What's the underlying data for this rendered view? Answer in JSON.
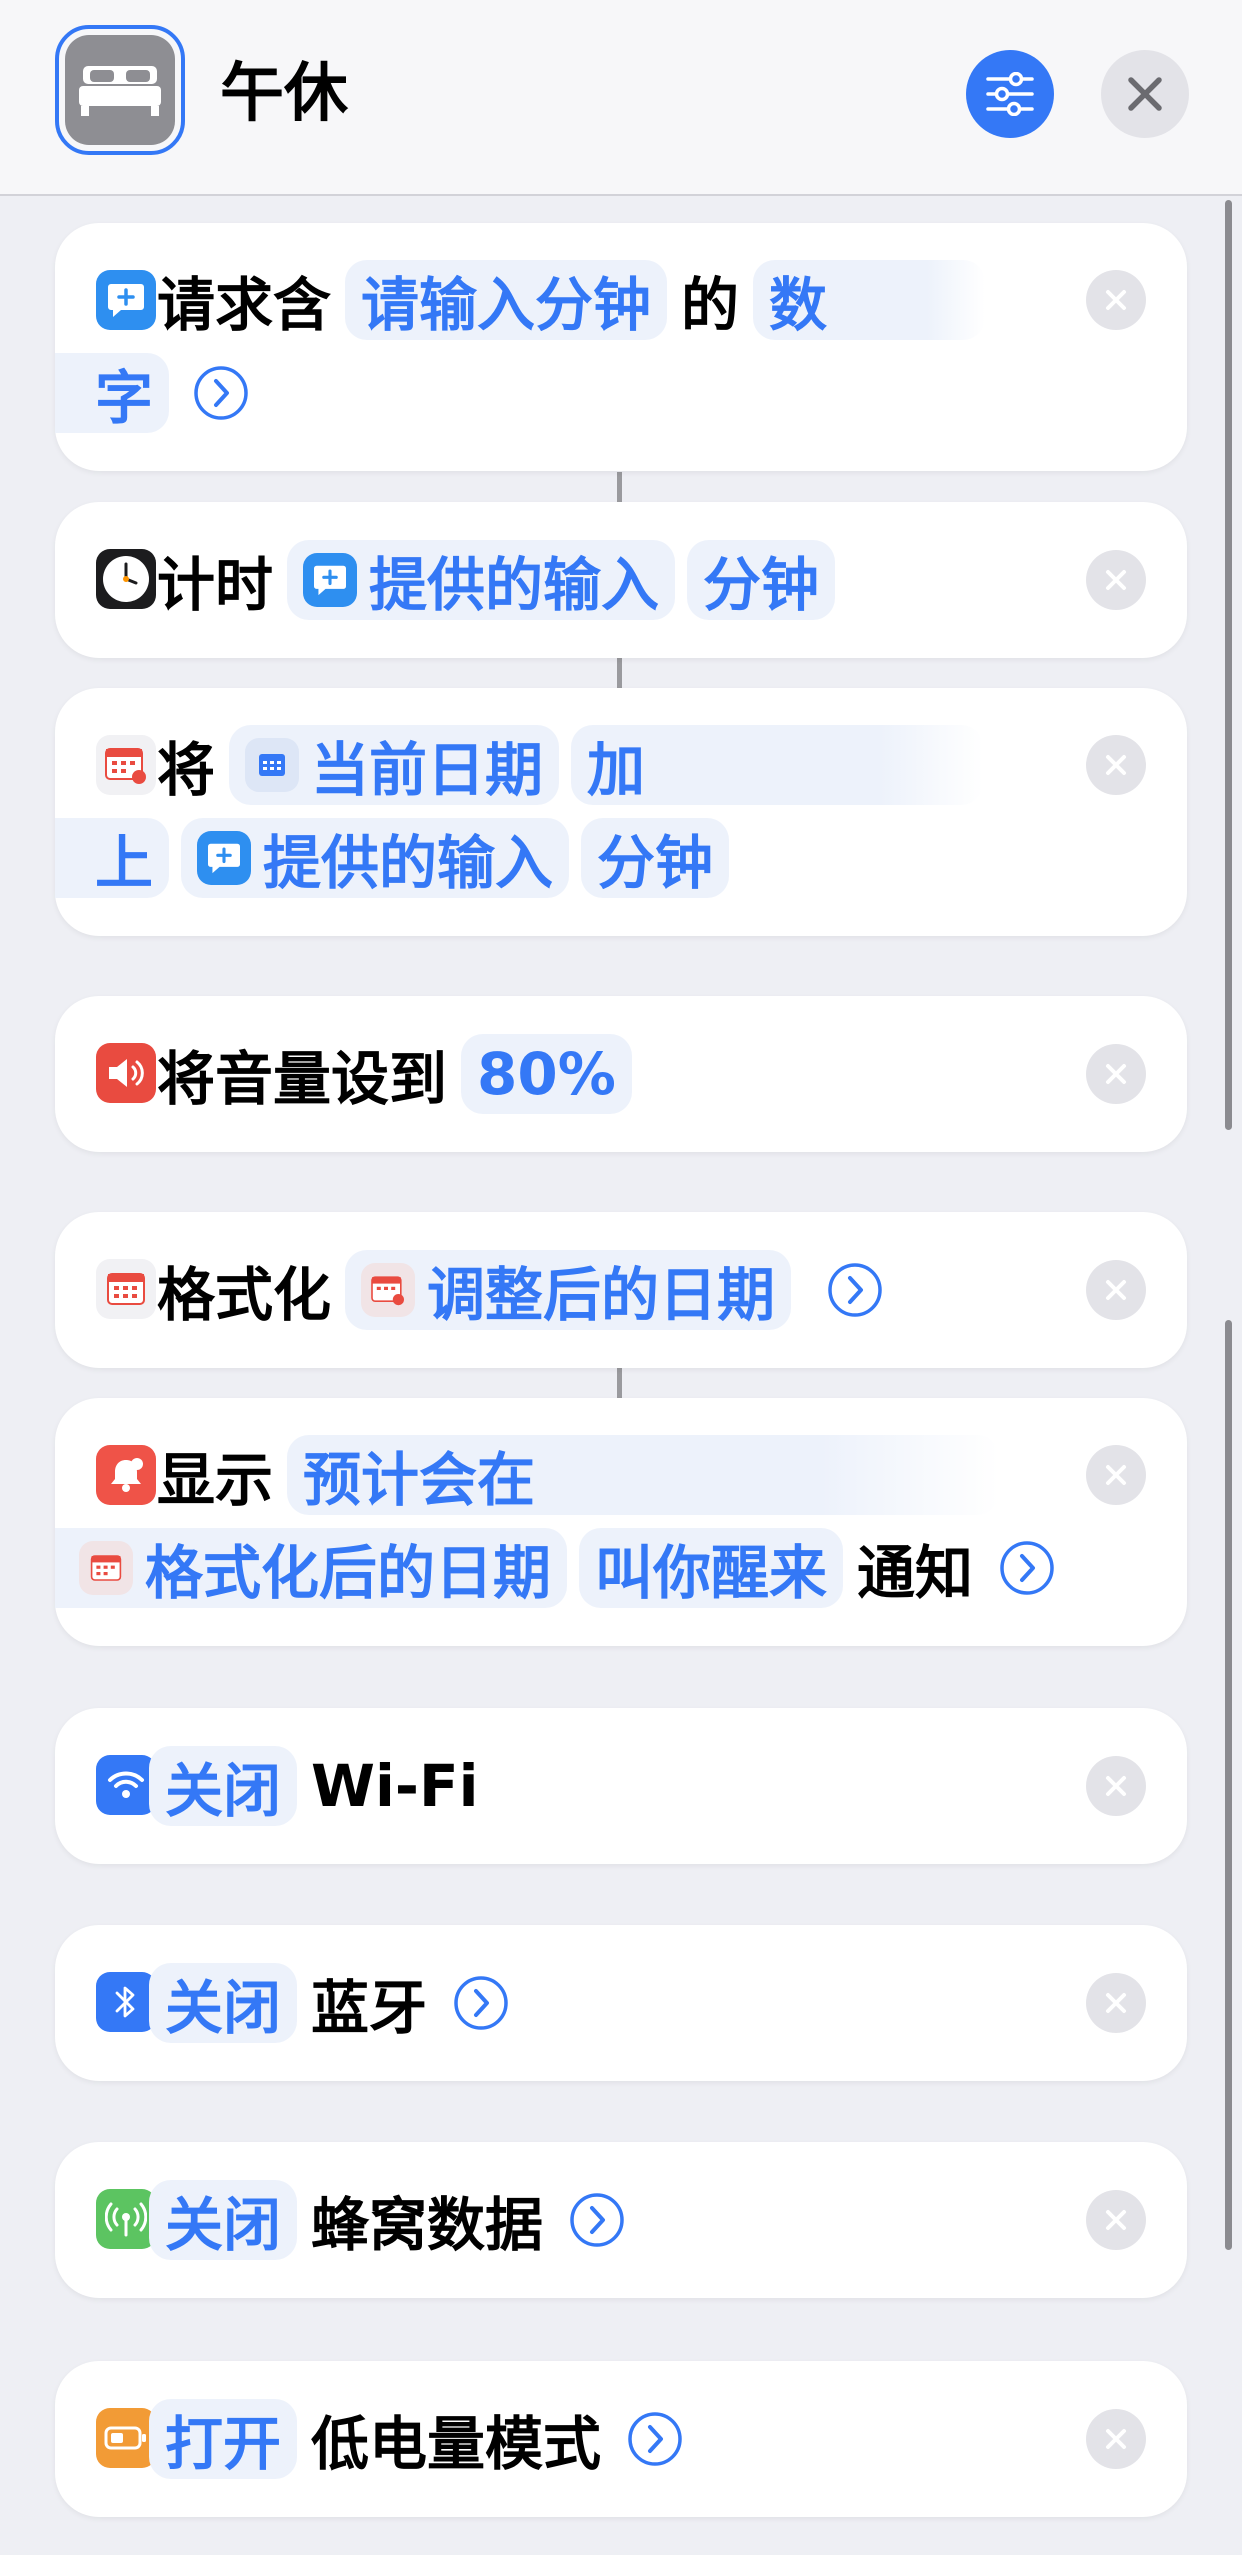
{
  "header": {
    "title": "午休"
  },
  "actions": [
    {
      "pre": "请求含",
      "token": "请输入分钟",
      "mid": "的",
      "token2_a": "数",
      "token2_b": "字"
    },
    {
      "pre": "计时",
      "token": "提供的输入",
      "token2": "分钟"
    },
    {
      "pre": "将",
      "token": "当前日期",
      "mid_a": "加",
      "mid_b": "上",
      "token2": "提供的输入",
      "token3": "分钟"
    },
    {
      "pre": "将音量设到",
      "token": "80%"
    },
    {
      "pre": "格式化",
      "token": "调整后的日期"
    },
    {
      "pre": "显示",
      "token_a": "预计会在",
      "token_b": "格式化后的日期",
      "token_c": "叫你醒来",
      "post": "通知"
    },
    {
      "token": "关闭",
      "post": "Wi-Fi"
    },
    {
      "token": "关闭",
      "post": "蓝牙"
    },
    {
      "token": "关闭",
      "post": "蜂窝数据"
    },
    {
      "token": "打开",
      "post": "低电量模式"
    }
  ],
  "colors": {
    "accent": "#3478f6",
    "ask_icon": "#2e8ff0",
    "volume_icon": "#e94b40",
    "notify_icon": "#ef5348",
    "wifi_icon": "#3478f6",
    "bluetooth_icon": "#3478f6",
    "cellular_icon": "#5cc461",
    "battery_icon": "#f29b36"
  }
}
